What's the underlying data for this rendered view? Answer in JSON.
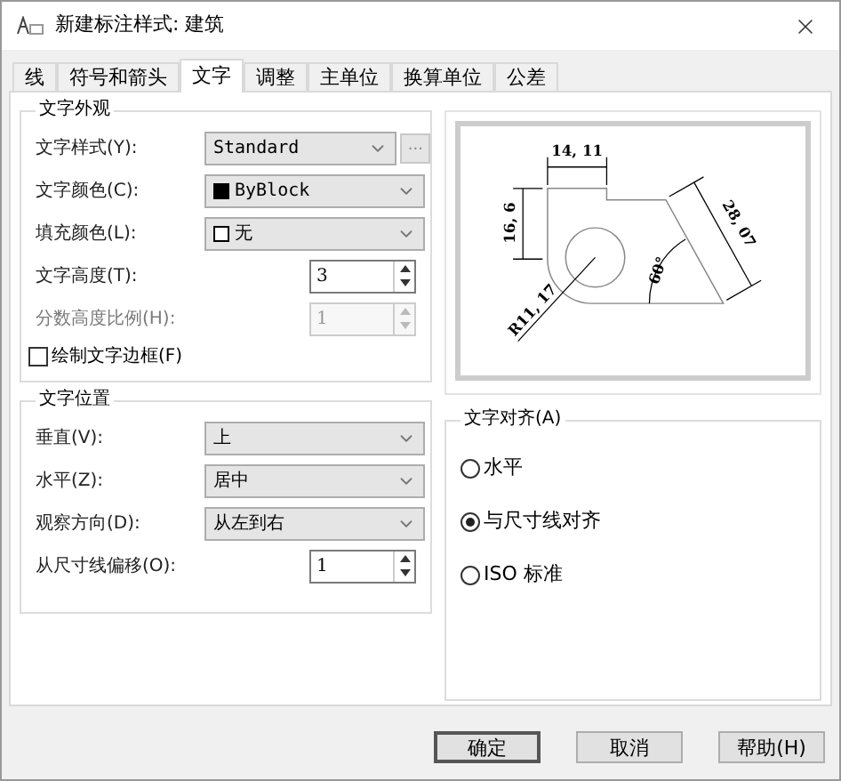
{
  "window": {
    "title": "新建标注样式: 建筑"
  },
  "tabs": [
    {
      "label": "线",
      "selected": false
    },
    {
      "label": "符号和箭头",
      "selected": false
    },
    {
      "label": "文字",
      "selected": true
    },
    {
      "label": "调整",
      "selected": false
    },
    {
      "label": "主单位",
      "selected": false
    },
    {
      "label": "换算单位",
      "selected": false
    },
    {
      "label": "公差",
      "selected": false
    }
  ],
  "appearance": {
    "title": "文字外观",
    "fields": [
      {
        "kind": "select",
        "label": "文字样式(Y):",
        "value": "Standard",
        "extra_button": "..."
      },
      {
        "kind": "select",
        "label": "文字颜色(C):",
        "value": "ByBlock",
        "color": "#000000"
      },
      {
        "kind": "select",
        "label": "填充颜色(L):",
        "value": "无",
        "color": "#ffffff"
      },
      {
        "kind": "spinner",
        "label": "文字高度(T):",
        "value": "3",
        "disabled": false
      },
      {
        "kind": "spinner",
        "label": "分数高度比例(H):",
        "value": "1",
        "disabled": true
      }
    ],
    "frame_checkbox": {
      "label": "绘制文字边框(F)",
      "checked": false
    }
  },
  "position": {
    "title": "文字位置",
    "fields": [
      {
        "kind": "select",
        "label": "垂直(V):",
        "value": "上"
      },
      {
        "kind": "select",
        "label": "水平(Z):",
        "value": "居中"
      },
      {
        "kind": "select",
        "label": "观察方向(D):",
        "value": "从左到右"
      },
      {
        "kind": "spinner",
        "label": "从尺寸线偏移(O):",
        "value": "1",
        "disabled": false
      }
    ]
  },
  "preview": {
    "labels": [
      "14, 11",
      "16, 6",
      "28, 07",
      "60°",
      "R11, 17"
    ]
  },
  "alignment": {
    "title": "文字对齐(A)",
    "options": [
      {
        "label": "水平",
        "selected": false
      },
      {
        "label": "与尺寸线对齐",
        "selected": true
      },
      {
        "label": "ISO 标准",
        "selected": false
      }
    ]
  },
  "buttons": [
    {
      "label": "确定",
      "default": true
    },
    {
      "label": "取消",
      "default": false
    },
    {
      "label": "帮助(H)",
      "default": false
    }
  ]
}
